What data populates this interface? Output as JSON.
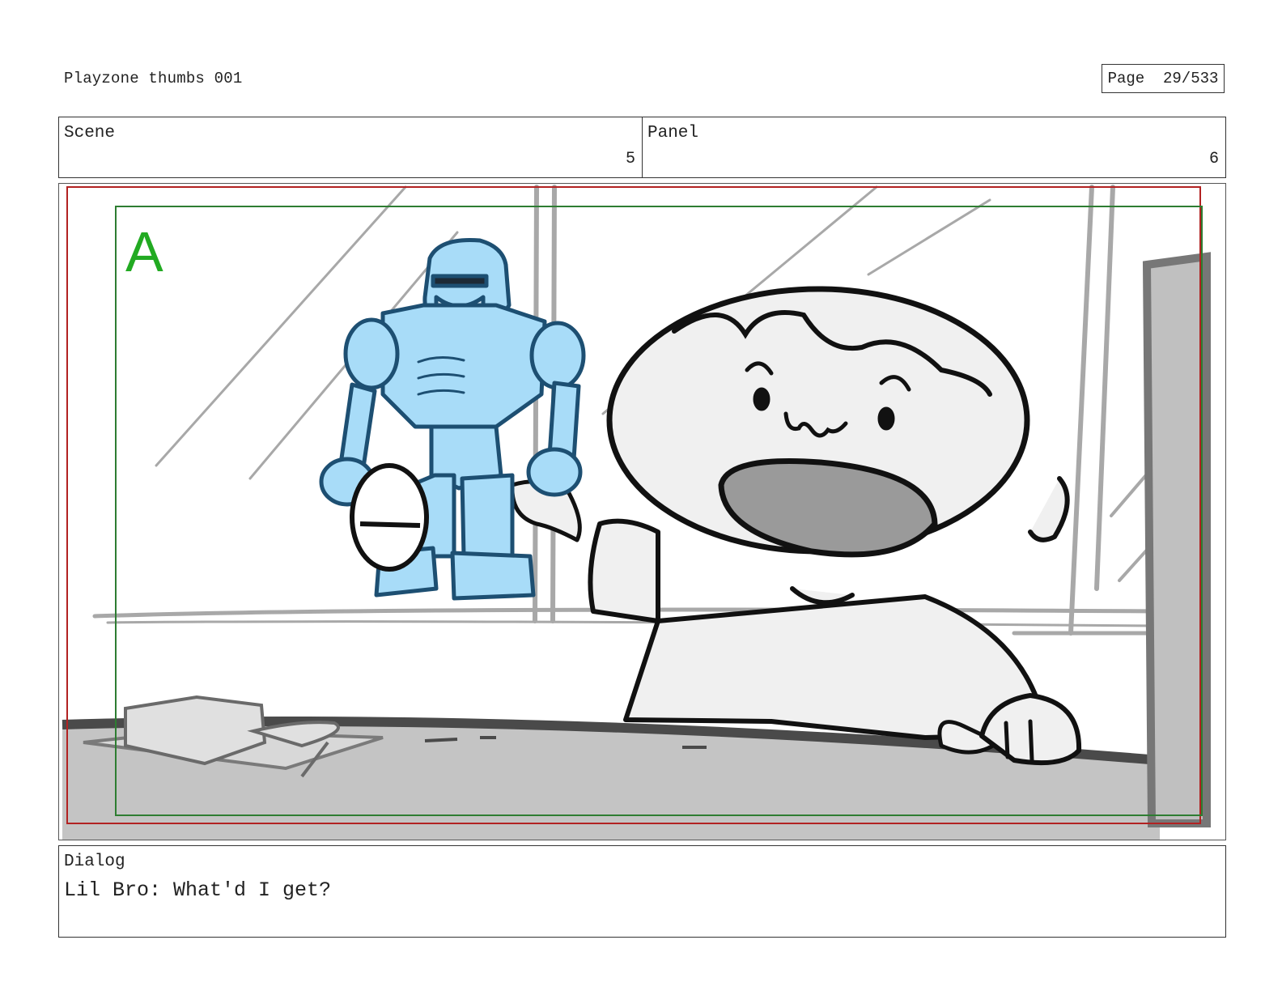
{
  "document": {
    "title": "Playzone thumbs 001",
    "page_label": "Page",
    "page_value": "29/533"
  },
  "scene": {
    "label": "Scene",
    "value": "5"
  },
  "panel": {
    "label": "Panel",
    "value": "6"
  },
  "frame": {
    "marker": "A",
    "colors": {
      "safe_frame": "#b22222",
      "action_frame": "#2e7d32",
      "marker": "#22aa22",
      "robot_fill": "#a8dcf8",
      "robot_line": "#1d4f72",
      "sketch_gray": "#9a9a9a",
      "table_fill": "#c4c4c4",
      "character_fill": "#f0f0f0"
    }
  },
  "dialog": {
    "label": "Dialog",
    "text": "Lil Bro: What'd I get?"
  }
}
